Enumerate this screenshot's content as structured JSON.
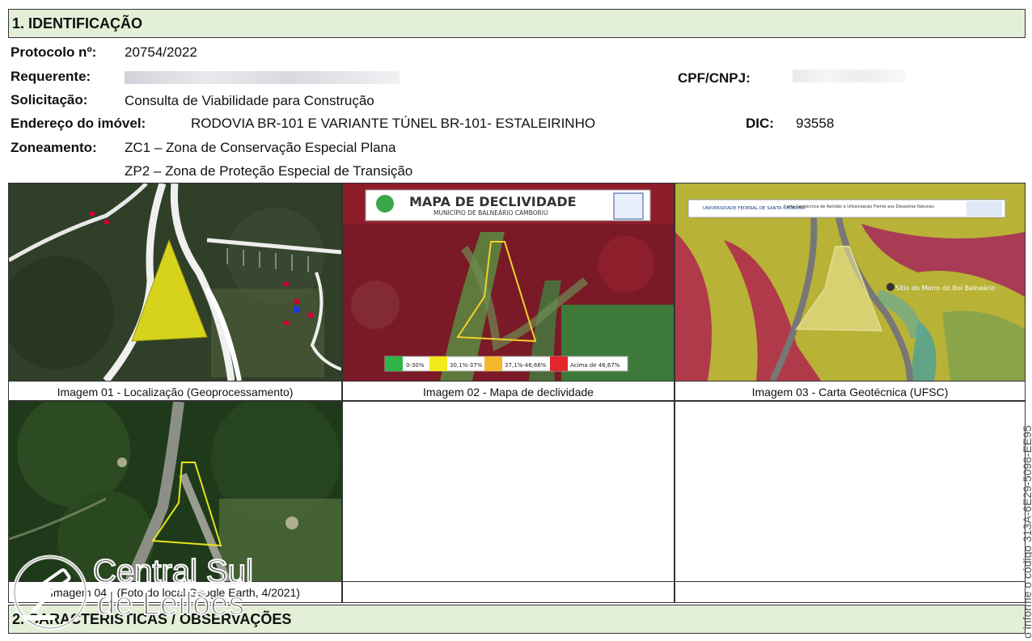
{
  "section1": {
    "title": "1. IDENTIFICAÇÃO"
  },
  "fields": {
    "protocolo_label": "Protocolo nº:",
    "protocolo_value": "20754/2022",
    "requerente_label": "Requerente:",
    "cpf_label": "CPF/CNPJ:",
    "solicitacao_label": "Solicitação:",
    "solicitacao_value": "Consulta de Viabilidade para Construção",
    "endereco_label": "Endereço do imóvel:",
    "endereco_value": "RODOVIA BR-101 E VARIANTE TÚNEL BR-101- ESTALEIRINHO",
    "dic_label": "DIC:",
    "dic_value": "93558",
    "zoneamento_label": "Zoneamento:",
    "zoneamento_1": "ZC1 – Zona de Conservação Especial Plana",
    "zoneamento_2": "ZP2 – Zona de Proteção Especial de Transição"
  },
  "images": {
    "img1_caption": "Imagem 01 - Localização (Geoprocessamento)",
    "img2_caption": "Imagem 02 - Mapa de declividade",
    "img3_caption": "Imagem 03 - Carta Geotécnica (UFSC)",
    "img4_caption": "Imagem 04 - (Foto do local Google Earth, 4/2021)",
    "map2_title": "MAPA DE DECLIVIDADE",
    "map2_subtitle": "MUNICÍPIO DE BALNEÁRIO CAMBORIÚ",
    "map2_legend": [
      "0-30%",
      "30,1%-37%",
      "37,1%-46,66%",
      "Acima de 46,67%"
    ],
    "map2_legend_colors": [
      "#2fb44a",
      "#f2ea1a",
      "#f6b72a",
      "#e2262a"
    ],
    "map3_header_left": "UNIVERSIDADE FEDERAL DE SANTA CATARINA",
    "map3_header_title": "Carta Geotécnica de Aptidão à Urbanização Frente aos Desastres Naturais",
    "map3_place": "Sítio do Morro do Boi Balneário"
  },
  "section2": {
    "title": "2. CARACTERÍSTICAS / OBSERVAÇÕES"
  },
  "side_text": "o informe o código 313A-6E29-5098-EE95",
  "watermark": {
    "line1": "Central Sul",
    "line2": "de Leilões"
  }
}
